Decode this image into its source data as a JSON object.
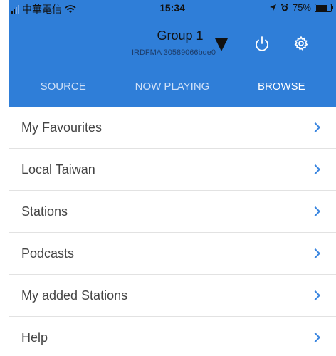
{
  "status_bar": {
    "carrier": "中華電信",
    "time": "15:34",
    "battery": "75%"
  },
  "header": {
    "group_title": "Group 1",
    "device_id": "IRDFMA 30589066bde0"
  },
  "tabs": [
    {
      "label": "SOURCE",
      "active": false
    },
    {
      "label": "NOW PLAYING",
      "active": false
    },
    {
      "label": "BROWSE",
      "active": true
    }
  ],
  "list": {
    "items": [
      {
        "label": "My Favourites"
      },
      {
        "label": "Local Taiwan"
      },
      {
        "label": "Stations"
      },
      {
        "label": "Podcasts"
      },
      {
        "label": "My added Stations"
      },
      {
        "label": "Help"
      }
    ]
  },
  "icons": {
    "power": "power-icon",
    "settings": "gear-icon",
    "dropdown": "triangle-down-icon",
    "chevron": "chevron-right-icon"
  },
  "colors": {
    "header_bg": "#2f7ed8",
    "chevron": "#3a86e0",
    "list_text": "#444444"
  }
}
